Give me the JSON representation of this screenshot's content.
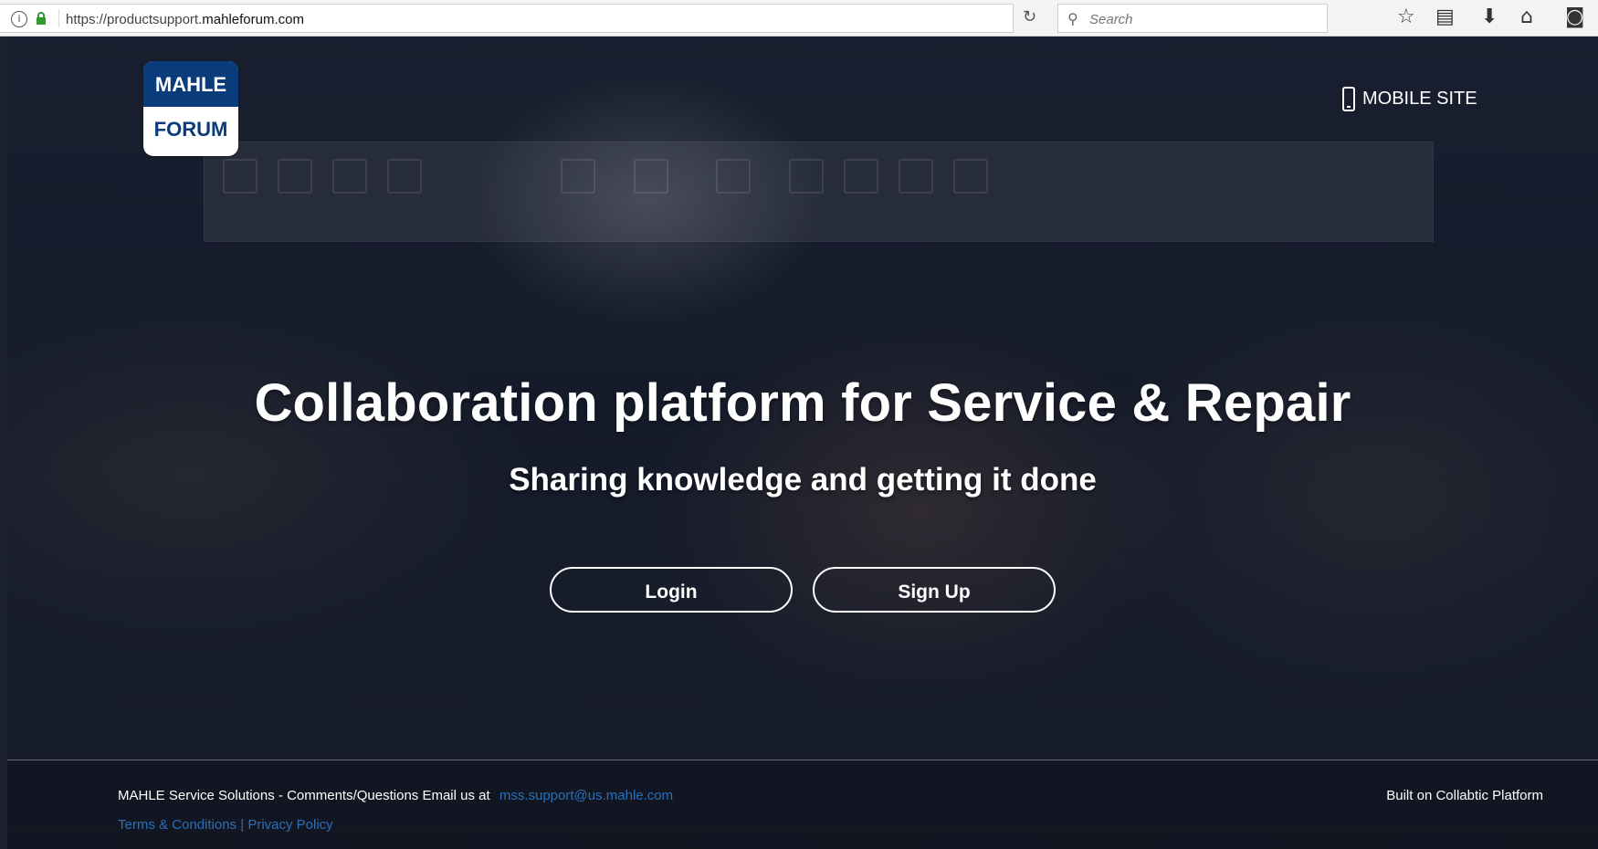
{
  "browser": {
    "url_prefix": "https://productsupport.",
    "url_domain": "mahleforum.com",
    "search_placeholder": "Search",
    "reload_icon": "reload-icon",
    "toolbar_icons": [
      "star-icon",
      "reading-list-icon",
      "download-icon",
      "home-icon",
      "pocket-icon"
    ]
  },
  "logo": {
    "line1": "MAHLE",
    "line2": "FORUM"
  },
  "header": {
    "mobile_site": "MOBILE SITE"
  },
  "hero": {
    "title": "Collaboration platform for Service & Repair",
    "subtitle": "Sharing knowledge and getting it done",
    "login_label": "Login",
    "signup_label": "Sign Up"
  },
  "footer": {
    "contact_text": "MAHLE Service Solutions - Comments/Questions Email us at",
    "email": "mss.support@us.mahle.com",
    "terms": "Terms & Conditions",
    "divider": "|",
    "privacy": "Privacy Policy",
    "built_on": "Built on Collabtic Platform"
  },
  "colors": {
    "logo_blue": "#0a3b7a",
    "link_blue": "#2a6fb8",
    "text_white": "#ffffff"
  }
}
